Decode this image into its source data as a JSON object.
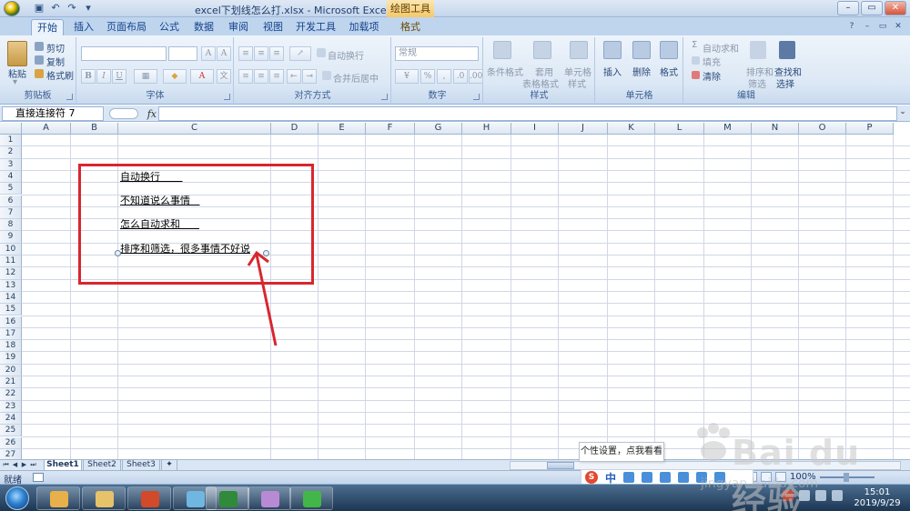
{
  "window": {
    "title": "excel下划线怎么打.xlsx - Microsoft Excel",
    "contextual_tab": "绘图工具"
  },
  "ribbon_tabs": [
    "开始",
    "插入",
    "页面布局",
    "公式",
    "数据",
    "审阅",
    "视图",
    "开发工具",
    "加载项",
    "格式"
  ],
  "ribbon": {
    "clipboard": {
      "paste": "粘贴",
      "cut": "剪切",
      "copy": "复制",
      "format_painter": "格式刷",
      "label": "剪贴板"
    },
    "font": {
      "label": "字体"
    },
    "alignment": {
      "wrap": "自动换行",
      "merge": "合并后居中",
      "label": "对齐方式"
    },
    "number": {
      "format": "常规",
      "label": "数字"
    },
    "styles": {
      "conditional": "条件格式",
      "table_line1": "套用",
      "table_line2": "表格格式",
      "cell_line1": "单元格",
      "cell_line2": "样式",
      "label": "样式"
    },
    "cells": {
      "insert": "插入",
      "delete": "删除",
      "format": "格式",
      "label": "单元格"
    },
    "editing": {
      "autosum": "自动求和",
      "fill": "填充",
      "clear": "清除",
      "sort_line1": "排序和",
      "sort_line2": "筛选",
      "find_line1": "查找和",
      "find_line2": "选择",
      "label": "编辑"
    }
  },
  "formula_bar": {
    "name_box": "直接连接符 7",
    "fx": "fx",
    "value": ""
  },
  "columns": [
    "A",
    "B",
    "C",
    "D",
    "E",
    "F",
    "G",
    "H",
    "I",
    "J",
    "K",
    "L",
    "M",
    "N",
    "O",
    "P"
  ],
  "rows": [
    "1",
    "2",
    "3",
    "4",
    "5",
    "6",
    "7",
    "8",
    "9",
    "10",
    "11",
    "12",
    "13",
    "14",
    "15",
    "16",
    "17",
    "18",
    "19",
    "20",
    "21",
    "22",
    "23",
    "24",
    "25",
    "26",
    "27"
  ],
  "cells": {
    "C4": "自动换行       ",
    "C6": "不知道说么事情   ",
    "C8": "怎么自动求和      ",
    "C10": "排序和筛选，很多事情不好说"
  },
  "sheet_tabs": [
    "Sheet1",
    "Sheet2",
    "Sheet3"
  ],
  "status": {
    "ready": "就绪",
    "zoom": "100%"
  },
  "ime": {
    "lang": "中",
    "tooltip": "个性设置，点我看看"
  },
  "clock": {
    "time": "15:01",
    "date": "2019/9/29"
  },
  "watermark": {
    "brand": "Bai du 经验",
    "url": "jingyan.baidu.com"
  },
  "colors": {
    "annotation_red": "#d8262e",
    "ribbon_blue": "#dce8f5",
    "gridline": "#d0d7e5"
  }
}
